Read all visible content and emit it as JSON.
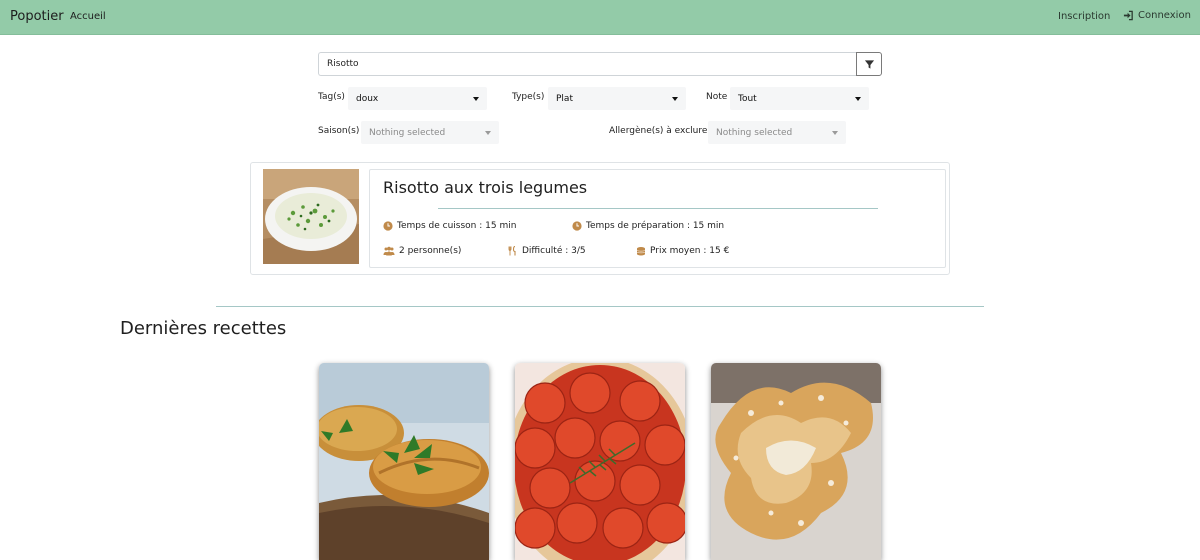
{
  "navbar": {
    "brand": "Popotier",
    "home": "Accueil",
    "signup": "Inscription",
    "login": "Connexion",
    "background": "#93cba8"
  },
  "search": {
    "value": "Risotto",
    "filter_icon": "filter-icon"
  },
  "filters": {
    "tags": {
      "label": "Tag(s)",
      "value": "doux"
    },
    "type": {
      "label": "Type(s)",
      "value": "Plat"
    },
    "note": {
      "label": "Note",
      "value": "Tout"
    },
    "season": {
      "label": "Saison(s)",
      "value": "Nothing selected"
    },
    "allergens": {
      "label": "Allergène(s) à exclure",
      "value": "Nothing selected"
    }
  },
  "result": {
    "title": "Risotto aux trois legumes",
    "cook_time": "Temps de cuisson : 15 min",
    "prep_time": "Temps de préparation : 15 min",
    "servings": "2 personne(s)",
    "difficulty": "Difficulté : 3/5",
    "price": "Prix moyen : 15 €",
    "icon_color": "#c08a4a"
  },
  "latest": {
    "title": "Dernières recettes",
    "items": [
      {
        "image": "empanadas-photo"
      },
      {
        "image": "tomato-tart-photo"
      },
      {
        "image": "fried-pastry-photo"
      }
    ]
  }
}
